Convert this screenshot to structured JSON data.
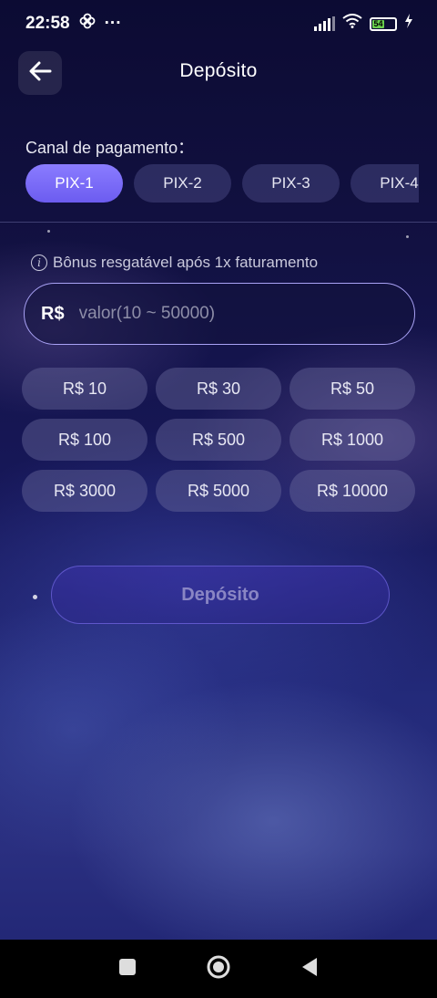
{
  "status_bar": {
    "time": "22:58",
    "dots": "···",
    "battery_level": "54"
  },
  "header": {
    "title": "Depósito"
  },
  "channel": {
    "label": "Canal de pagamento：",
    "tabs": [
      "PIX-1",
      "PIX-2",
      "PIX-3",
      "PIX-4"
    ],
    "active_index": 0
  },
  "bonus_note": "Bônus resgatável após 1x faturamento",
  "amount": {
    "currency": "R$",
    "placeholder": "valor(10 ~ 50000)",
    "value": ""
  },
  "presets": [
    "R$ 10",
    "R$ 30",
    "R$ 50",
    "R$ 100",
    "R$ 500",
    "R$ 1000",
    "R$ 3000",
    "R$ 5000",
    "R$ 10000"
  ],
  "deposit_button": {
    "label": "Depósito"
  },
  "colors": {
    "accent": "#6c5cf0",
    "input_border": "#a9a2f5",
    "battery": "#6ad04e"
  },
  "icons": {
    "back": "arrow-left-icon",
    "info": "info-icon",
    "wifi": "wifi-icon",
    "signal": "signal-icon"
  }
}
